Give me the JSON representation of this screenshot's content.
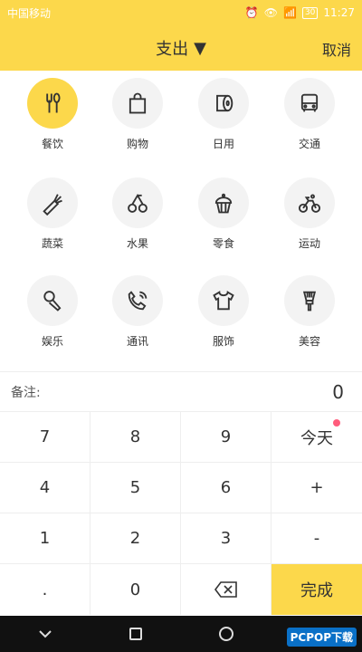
{
  "status": {
    "carrier": "中国移动",
    "time": "11:27",
    "battery": "30"
  },
  "header": {
    "title": "支出",
    "cancel": "取消"
  },
  "categories": [
    {
      "label": "餐饮",
      "icon": "utensils-icon",
      "active": true
    },
    {
      "label": "购物",
      "icon": "shopping-bag-icon"
    },
    {
      "label": "日用",
      "icon": "toilet-paper-icon"
    },
    {
      "label": "交通",
      "icon": "bus-icon"
    },
    {
      "label": "蔬菜",
      "icon": "carrot-icon"
    },
    {
      "label": "水果",
      "icon": "cherry-icon"
    },
    {
      "label": "零食",
      "icon": "cupcake-icon"
    },
    {
      "label": "运动",
      "icon": "bicycle-icon"
    },
    {
      "label": "娱乐",
      "icon": "microphone-icon"
    },
    {
      "label": "通讯",
      "icon": "phone-icon"
    },
    {
      "label": "服饰",
      "icon": "tshirt-icon"
    },
    {
      "label": "美容",
      "icon": "brush-icon"
    }
  ],
  "note": {
    "label": "备注:",
    "amount": "0"
  },
  "keypad": {
    "k7": "7",
    "k8": "8",
    "k9": "9",
    "today": "今天",
    "k4": "4",
    "k5": "5",
    "k6": "6",
    "plus": "+",
    "k1": "1",
    "k2": "2",
    "k3": "3",
    "minus": "-",
    "dot": ".",
    "k0": "0",
    "done": "完成"
  },
  "watermark": "PCPOP下载",
  "colors": {
    "accent": "#fcd84b",
    "badge": "#ff5c7c"
  }
}
